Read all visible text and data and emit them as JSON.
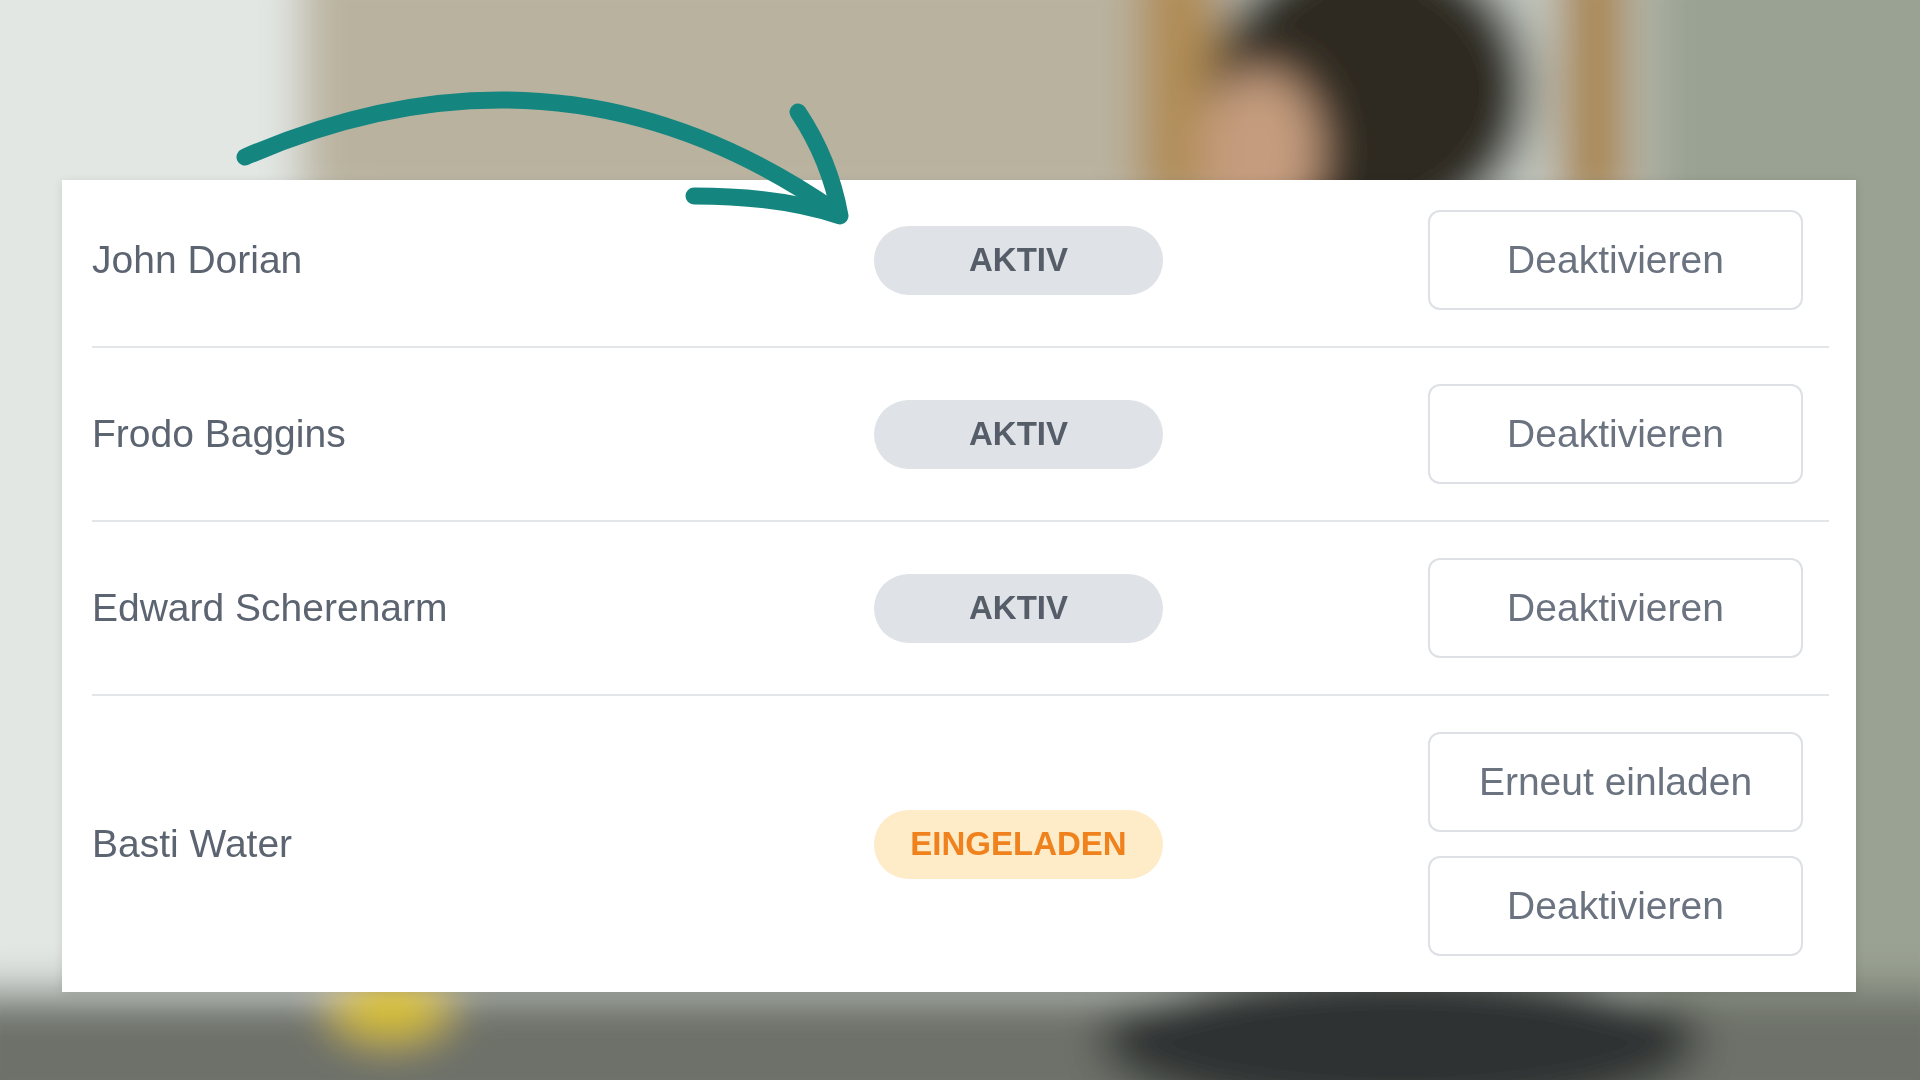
{
  "members": [
    {
      "name": "John Dorian",
      "status": {
        "label": "AKTIV",
        "kind": "active"
      },
      "actions": [
        "Deaktivieren"
      ]
    },
    {
      "name": "Frodo Baggins",
      "status": {
        "label": "AKTIV",
        "kind": "active"
      },
      "actions": [
        "Deaktivieren"
      ]
    },
    {
      "name": "Edward Scherenarm",
      "status": {
        "label": "AKTIV",
        "kind": "active"
      },
      "actions": [
        "Deaktivieren"
      ]
    },
    {
      "name": "Basti Water",
      "status": {
        "label": "EINGELADEN",
        "kind": "invited"
      },
      "actions": [
        "Erneut einladen",
        "Deaktivieren"
      ]
    }
  ]
}
